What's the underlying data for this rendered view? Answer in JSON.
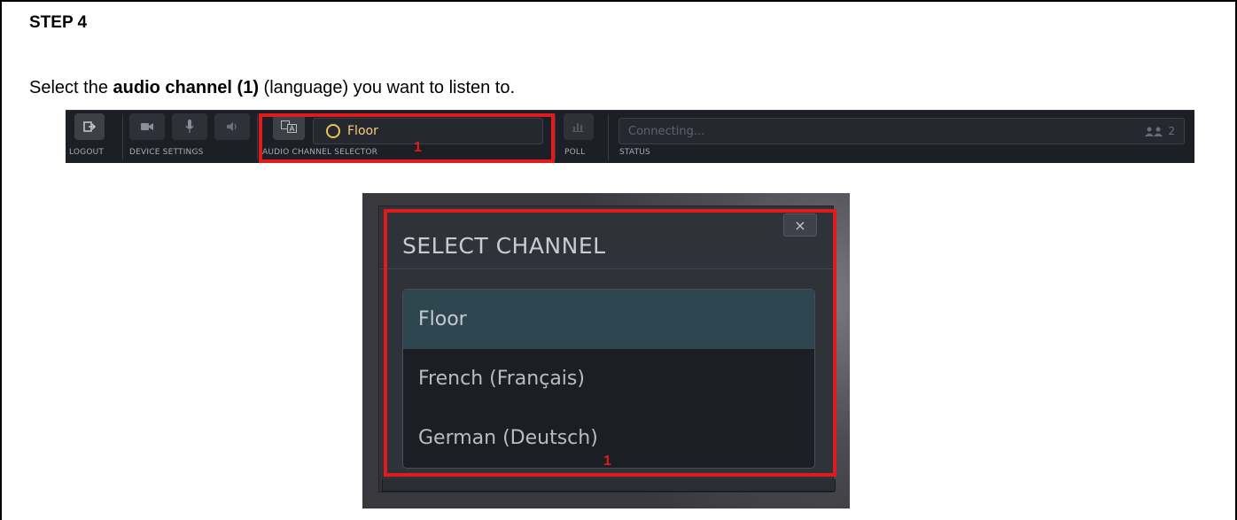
{
  "step_title": "STEP 4",
  "instruction": {
    "pre": "Select the ",
    "bold": "audio channel (1)",
    "post": " (language) you want to listen to."
  },
  "toolbar": {
    "labels": {
      "logout": "LOGOUT",
      "device_settings": "DEVICE SETTINGS",
      "audio_channel_selector": "AUDIO CHANNEL SELECTOR",
      "poll": "POLL",
      "status": "STATUS"
    },
    "channel_current": "Floor",
    "status_text": "Connecting...",
    "participant_count": "2",
    "icons": [
      "logout-icon",
      "camera-icon",
      "microphone-icon",
      "speaker-icon",
      "translate-icon",
      "poll-icon",
      "users-icon"
    ],
    "accent_color": "#e8c35a"
  },
  "markers": {
    "toolbar_marker": "1",
    "dialog_marker": "1",
    "highlight_color": "#e11b1b"
  },
  "dialog": {
    "title": "SELECT CHANNEL",
    "close_label": "×",
    "channels": [
      {
        "label": "Floor",
        "selected": true
      },
      {
        "label": "French (Français)",
        "selected": false
      },
      {
        "label": "German (Deutsch)",
        "selected": false
      }
    ],
    "selected_color": "#2d4650"
  }
}
